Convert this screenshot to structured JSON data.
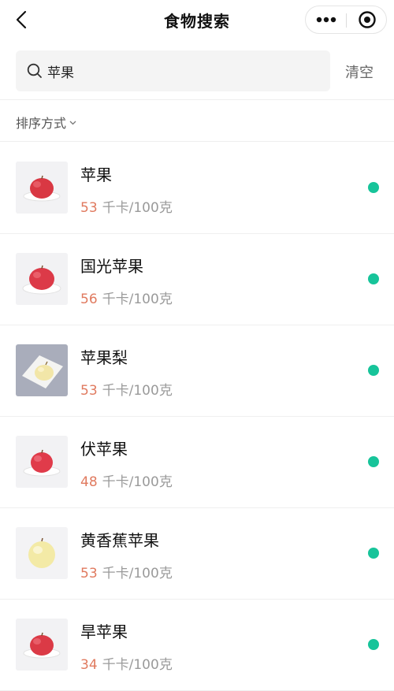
{
  "nav": {
    "title": "食物搜索"
  },
  "search": {
    "value": "苹果",
    "clear_label": "清空"
  },
  "sort": {
    "label": "排序方式"
  },
  "colors": {
    "accent_dot": "#17c49a",
    "calorie_number": "#e07a5f"
  },
  "foods": [
    {
      "name": "苹果",
      "calories": "53",
      "unit": "千卡/100克",
      "thumb": "red-apple-on-plate"
    },
    {
      "name": "国光苹果",
      "calories": "56",
      "unit": "千卡/100克",
      "thumb": "red-apple-on-plate"
    },
    {
      "name": "苹果梨",
      "calories": "53",
      "unit": "千卡/100克",
      "thumb": "yellow-pear-on-plate"
    },
    {
      "name": "伏苹果",
      "calories": "48",
      "unit": "千卡/100克",
      "thumb": "red-apple-on-plate"
    },
    {
      "name": "黄香蕉苹果",
      "calories": "53",
      "unit": "千卡/100克",
      "thumb": "yellow-apple"
    },
    {
      "name": "旱苹果",
      "calories": "34",
      "unit": "千卡/100克",
      "thumb": "red-apple-on-plate"
    }
  ]
}
